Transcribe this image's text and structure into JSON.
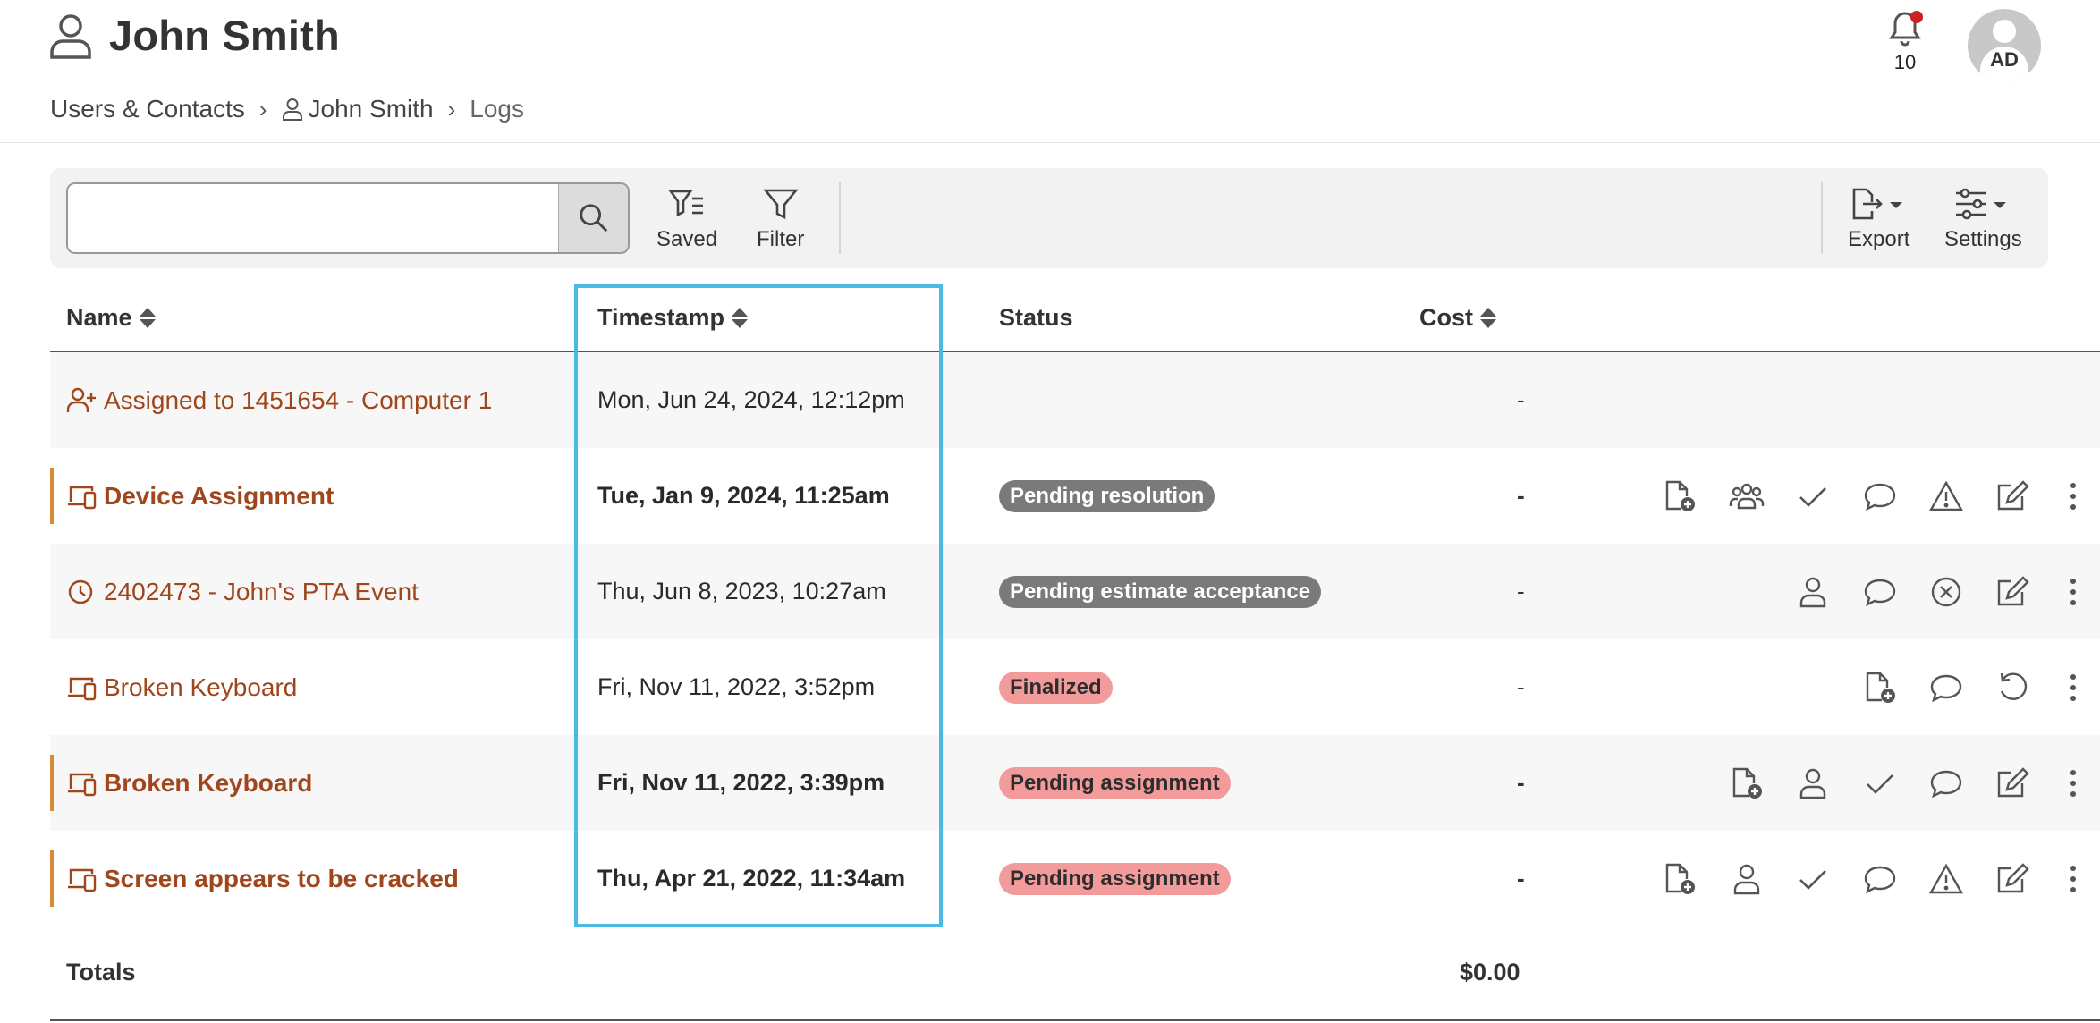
{
  "header": {
    "title": "John Smith",
    "notifications_count": "10",
    "avatar_initials": "AD"
  },
  "breadcrumb": {
    "items": [
      "Users & Contacts",
      "John Smith",
      "Logs"
    ]
  },
  "toolbar": {
    "search_value": "",
    "saved_label": "Saved",
    "filter_label": "Filter",
    "export_label": "Export",
    "settings_label": "Settings"
  },
  "table": {
    "columns": {
      "name": "Name",
      "timestamp": "Timestamp",
      "status": "Status",
      "cost": "Cost"
    },
    "rows": [
      {
        "name": "Assigned to 1451654 - Computer 1",
        "icon": "user-plus-icon",
        "timestamp": "Mon, Jun 24, 2024, 12:12pm",
        "status": "",
        "cost": "-",
        "bold": false,
        "flag": false,
        "actions": []
      },
      {
        "name": "Device Assignment",
        "icon": "devices-icon",
        "timestamp": "Tue, Jan 9, 2024, 11:25am",
        "status": "Pending resolution",
        "status_color": "gray",
        "cost": "-",
        "bold": true,
        "flag": true,
        "actions": [
          "file-add-icon",
          "users-icon",
          "check-icon",
          "comment-icon",
          "warning-icon",
          "edit-icon",
          "more-vertical-icon"
        ]
      },
      {
        "name": "2402473 - John's PTA Event",
        "icon": "clock-icon",
        "timestamp": "Thu, Jun 8, 2023, 10:27am",
        "status": "Pending estimate acceptance",
        "status_color": "gray",
        "cost": "-",
        "bold": false,
        "flag": false,
        "actions": [
          "user-icon",
          "comment-icon",
          "cancel-circle-icon",
          "edit-icon",
          "more-vertical-icon"
        ]
      },
      {
        "name": "Broken Keyboard",
        "icon": "devices-icon",
        "timestamp": "Fri, Nov 11, 2022, 3:52pm",
        "status": "Finalized",
        "status_color": "red",
        "cost": "-",
        "bold": false,
        "flag": false,
        "actions": [
          "file-add-icon",
          "comment-icon",
          "undo-icon",
          "more-vertical-icon"
        ]
      },
      {
        "name": "Broken Keyboard",
        "icon": "devices-icon",
        "timestamp": "Fri, Nov 11, 2022, 3:39pm",
        "status": "Pending assignment",
        "status_color": "red",
        "cost": "-",
        "bold": true,
        "flag": true,
        "actions": [
          "file-add-icon",
          "user-icon",
          "check-icon",
          "comment-icon",
          "edit-icon",
          "more-vertical-icon"
        ]
      },
      {
        "name": "Screen appears to be cracked",
        "icon": "devices-icon",
        "timestamp": "Thu, Apr 21, 2022, 11:34am",
        "status": "Pending assignment",
        "status_color": "red",
        "cost": "-",
        "bold": true,
        "flag": true,
        "actions": [
          "file-add-icon",
          "user-icon",
          "check-icon",
          "comment-icon",
          "warning-icon",
          "edit-icon",
          "more-vertical-icon"
        ]
      }
    ],
    "totals_label": "Totals",
    "totals_cost": "$0.00"
  },
  "colors": {
    "link": "#a0461c",
    "flag": "#d88a3b",
    "badge_gray": "#7a7a7a",
    "badge_red": "#f39b9b",
    "column_highlight": "#4cb8e6",
    "notification_dot": "#cc2222"
  }
}
